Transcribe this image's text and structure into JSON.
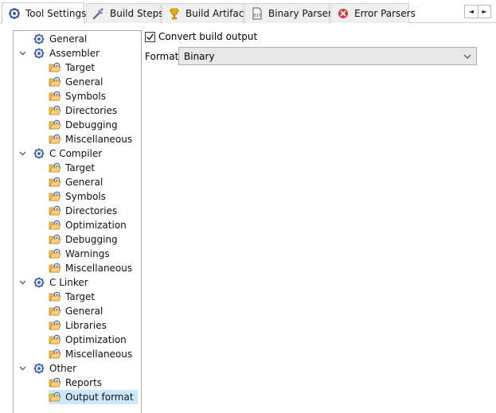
{
  "tabs": [
    {
      "label": "Tool Settings",
      "icon": "tool-settings-icon",
      "active": true
    },
    {
      "label": "Build Steps",
      "icon": "build-steps-icon",
      "active": false
    },
    {
      "label": "Build Artifact",
      "icon": "build-artifact-icon",
      "active": false
    },
    {
      "label": "Binary Parsers",
      "icon": "binary-parsers-icon",
      "active": false
    },
    {
      "label": "Error Parsers",
      "icon": "error-parsers-icon",
      "active": false
    }
  ],
  "tab_scroll": {
    "left": "◄",
    "right": "►"
  },
  "tree": [
    {
      "label": "General",
      "level": 1
    },
    {
      "label": "Assembler",
      "level": 0,
      "expanded": true
    },
    {
      "label": "Target",
      "level": 2
    },
    {
      "label": "General",
      "level": 2
    },
    {
      "label": "Symbols",
      "level": 2
    },
    {
      "label": "Directories",
      "level": 2
    },
    {
      "label": "Debugging",
      "level": 2
    },
    {
      "label": "Miscellaneous",
      "level": 2
    },
    {
      "label": "C Compiler",
      "level": 0,
      "expanded": true
    },
    {
      "label": "Target",
      "level": 2
    },
    {
      "label": "General",
      "level": 2
    },
    {
      "label": "Symbols",
      "level": 2
    },
    {
      "label": "Directories",
      "level": 2
    },
    {
      "label": "Optimization",
      "level": 2
    },
    {
      "label": "Debugging",
      "level": 2
    },
    {
      "label": "Warnings",
      "level": 2
    },
    {
      "label": "Miscellaneous",
      "level": 2
    },
    {
      "label": "C Linker",
      "level": 0,
      "expanded": true
    },
    {
      "label": "Target",
      "level": 2
    },
    {
      "label": "General",
      "level": 2
    },
    {
      "label": "Libraries",
      "level": 2
    },
    {
      "label": "Optimization",
      "level": 2
    },
    {
      "label": "Miscellaneous",
      "level": 2
    },
    {
      "label": "Other",
      "level": 0,
      "expanded": true
    },
    {
      "label": "Reports",
      "level": 2
    },
    {
      "label": "Output format",
      "level": 2,
      "selected": true
    }
  ],
  "settings": {
    "convert_label": "Convert build output",
    "convert_checked": true,
    "format_label": "Format",
    "format_value": "Binary"
  },
  "colors": {
    "selection": "#cce8ff",
    "folder": "#f5c15c",
    "gear": "#3b5aa6"
  }
}
